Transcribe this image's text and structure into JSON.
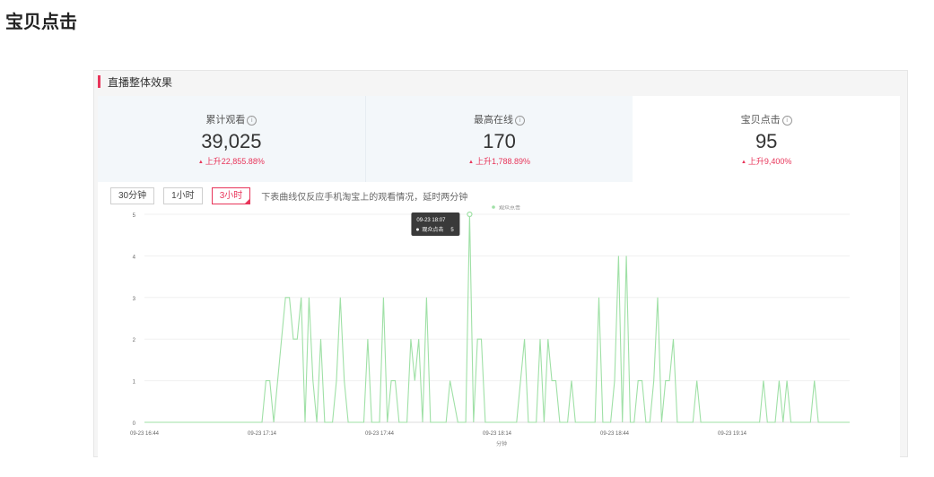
{
  "page_title": "宝贝点击",
  "card": {
    "title": "直播整体效果",
    "stats": [
      {
        "label": "累计观看",
        "value": "39,025",
        "change": "上升22,855.88%"
      },
      {
        "label": "最高在线",
        "value": "170",
        "change": "上升1,788.89%"
      },
      {
        "label": "宝贝点击",
        "value": "95",
        "change": "上升9,400%"
      }
    ],
    "time_buttons": [
      "30分钟",
      "1小时",
      "3小时"
    ],
    "active_button": "3小时",
    "hint": "下表曲线仅反应手机淘宝上的观看情况，延时两分钟"
  },
  "chart_data": {
    "type": "line",
    "title": "",
    "xlabel": "分钟",
    "ylabel": "",
    "ylim": [
      0,
      5
    ],
    "yticks": [
      0,
      1,
      2,
      3,
      4,
      5
    ],
    "xticks": [
      "09-23 16:44",
      "09-23 17:14",
      "09-23 17:44",
      "09-23 18:14",
      "09-23 18:44",
      "09-23 19:14"
    ],
    "legend": "top-center",
    "series": [
      {
        "name": "观众点击",
        "color": "#9fe0a6",
        "x_minutes": [
          0,
          30,
          31,
          32,
          33,
          35,
          36,
          37,
          38,
          39,
          40,
          41,
          42,
          43,
          44,
          45,
          46,
          47,
          48,
          49,
          50,
          51,
          52,
          53,
          56,
          57,
          58,
          60,
          61,
          62,
          63,
          64,
          65,
          67,
          68,
          69,
          70,
          71,
          72,
          73,
          74,
          75,
          76,
          77,
          78,
          80,
          81,
          82,
          83,
          84,
          85,
          86,
          87,
          88,
          89,
          90,
          91,
          95,
          97,
          98,
          99,
          100,
          101,
          102,
          103,
          104,
          105,
          106,
          107,
          108,
          109,
          110,
          111,
          112,
          113,
          114,
          115,
          116,
          117,
          118,
          119,
          120,
          121,
          122,
          123,
          124,
          125,
          126,
          127,
          128,
          129,
          130,
          131,
          132,
          133,
          134,
          135,
          136,
          137,
          138,
          139,
          140,
          141,
          142,
          143,
          144,
          145,
          146,
          147,
          148,
          149,
          150,
          151,
          152,
          153,
          154,
          155,
          156,
          157,
          158,
          159,
          160,
          161,
          162,
          163,
          164,
          165,
          166,
          167,
          168,
          169,
          170,
          171,
          172,
          173,
          174,
          175,
          176,
          177,
          178,
          179,
          180
        ],
        "values": [
          0,
          0,
          1,
          1,
          0,
          2,
          3,
          3,
          2,
          2,
          3,
          0,
          3,
          1,
          0,
          2,
          0,
          0,
          0,
          1,
          3,
          1,
          0,
          0,
          0,
          2,
          0,
          0,
          3,
          0,
          1,
          1,
          0,
          0,
          2,
          1,
          2,
          0,
          3,
          0,
          0,
          0,
          0,
          0,
          1,
          0,
          0,
          0,
          5,
          0,
          2,
          2,
          0,
          0,
          0,
          0,
          0,
          0,
          2,
          0,
          0,
          0,
          2,
          0,
          2,
          1,
          1,
          0,
          0,
          0,
          1,
          0,
          0,
          0,
          0,
          0,
          0,
          3,
          0,
          0,
          0,
          1,
          4,
          0,
          4,
          0,
          0,
          1,
          1,
          0,
          0,
          1,
          3,
          0,
          1,
          1,
          2,
          0,
          0,
          0,
          0,
          0,
          1,
          0,
          0,
          0,
          0,
          0,
          0,
          0,
          0,
          0,
          0,
          0,
          0,
          0,
          0,
          0,
          0,
          1,
          0,
          0,
          0,
          1,
          0,
          1,
          0,
          0,
          0,
          0,
          0,
          0,
          1,
          0,
          0,
          0,
          0,
          0,
          0,
          0,
          0,
          0,
          0,
          0,
          0,
          0,
          0,
          0,
          0
        ]
      }
    ],
    "tooltip": {
      "time": "09-23 18:07",
      "label": "观众点击",
      "value": "5"
    }
  }
}
